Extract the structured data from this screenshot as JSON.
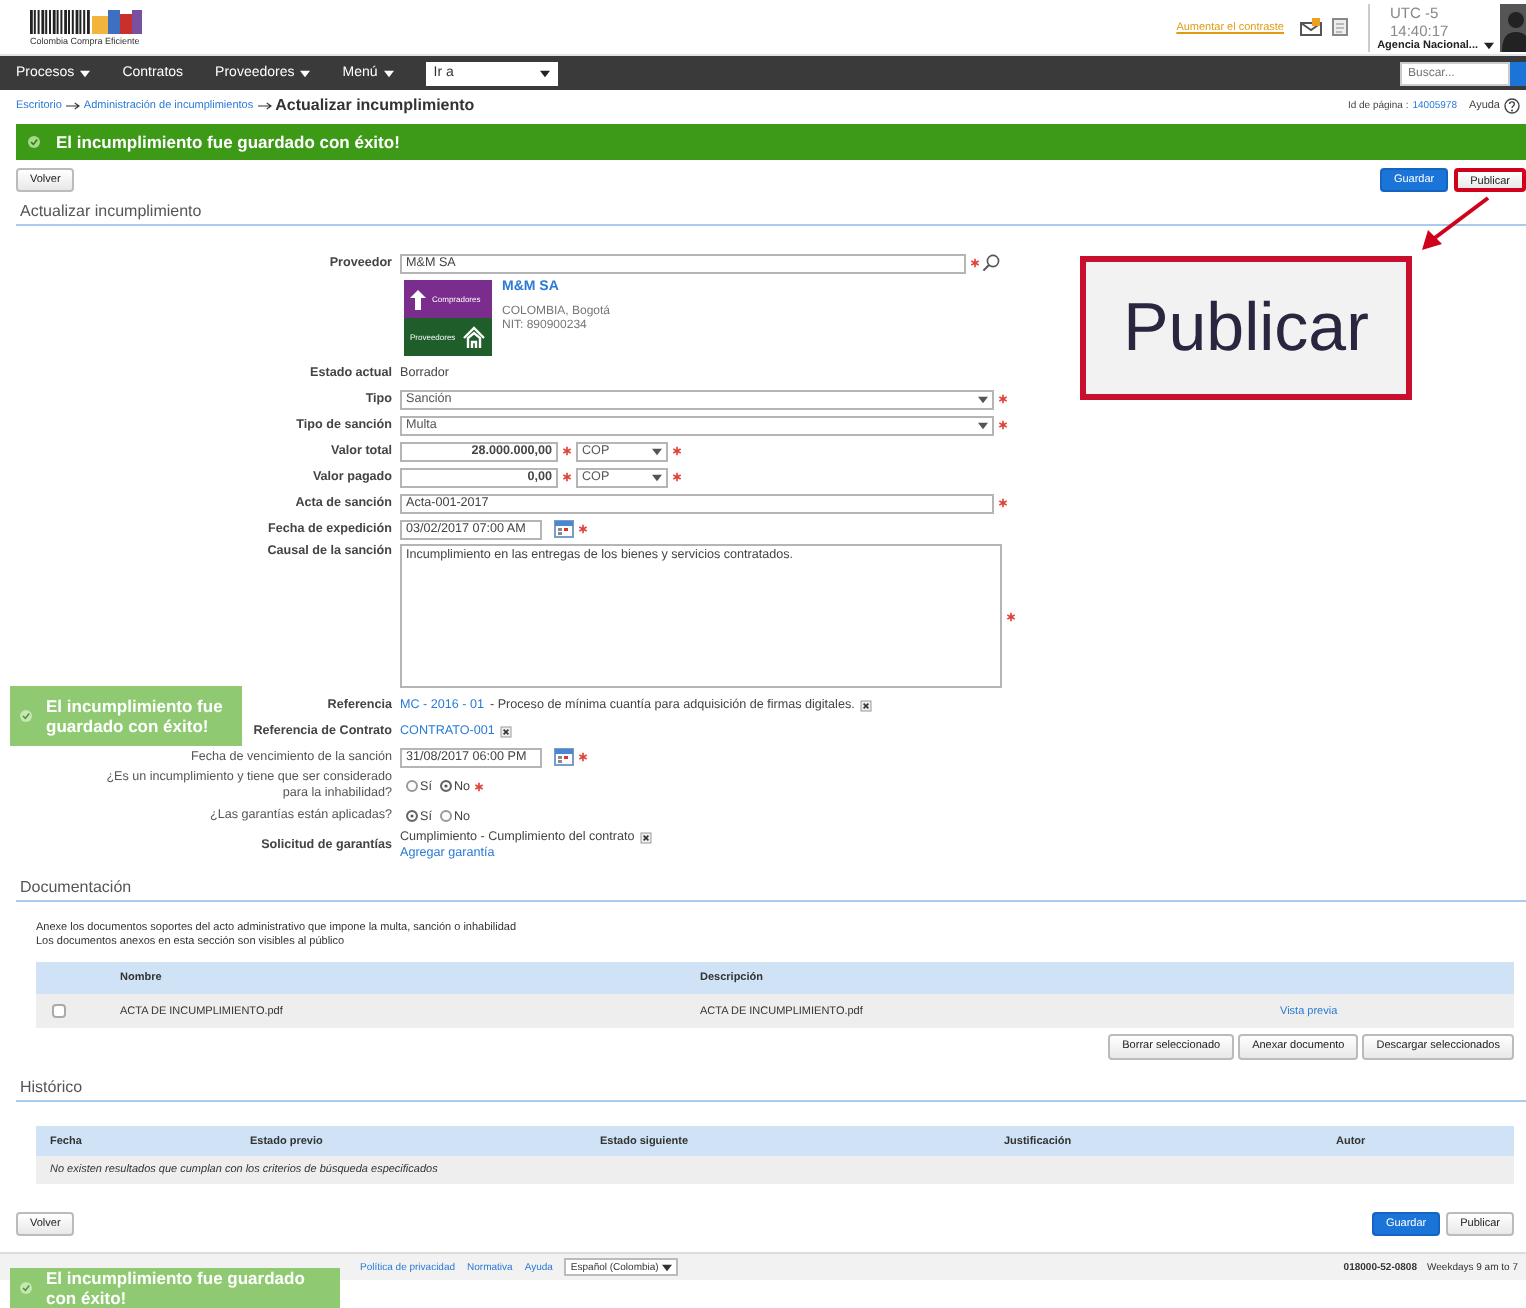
{
  "header": {
    "logo_text": "Colombia Compra Eficiente",
    "contrast_link": "Aumentar el contraste",
    "time": "UTC -5 14:40:17",
    "agency": "Agencia Nacional..."
  },
  "nav": {
    "items": [
      {
        "label": "Procesos",
        "dropdown": true
      },
      {
        "label": "Contratos",
        "dropdown": false
      },
      {
        "label": "Proveedores",
        "dropdown": true
      },
      {
        "label": "Menú",
        "dropdown": true
      }
    ],
    "goto": "Ir a",
    "search_placeholder": "Buscar..."
  },
  "breadcrumb": {
    "links": [
      "Escritorio",
      "Administración de incumplimientos"
    ],
    "current": "Actualizar incumplimiento",
    "page_id_label": "Id de página :",
    "page_id": "14005978",
    "help": "Ayuda"
  },
  "banner": {
    "message": "El incumplimiento fue guardado con éxito!"
  },
  "top_actions": {
    "back": "Volver",
    "save": "Guardar",
    "publish": "Publicar",
    "publish_highlighted": true
  },
  "form": {
    "title": "Actualizar incumplimiento",
    "rows": [
      {
        "kind": "provider",
        "label": "Proveedor",
        "value": "M&M SA",
        "required": true
      },
      {
        "kind": "card",
        "name": "M&M SA",
        "location": "COLOMBIA, Bogotá",
        "nit": "NIT: 890900234",
        "logo_top": "Compradores",
        "logo_bottom": "Proveedores"
      },
      {
        "kind": "static",
        "label": "Estado actual",
        "value": "Borrador"
      },
      {
        "kind": "select",
        "label": "Tipo",
        "value": "Sanción",
        "required": true
      },
      {
        "kind": "select",
        "label": "Tipo de sanción",
        "value": "Multa",
        "required": true
      },
      {
        "kind": "amount",
        "label": "Valor total",
        "value": "28.000.000,00",
        "currency": "COP",
        "required": true
      },
      {
        "kind": "amount",
        "label": "Valor pagado",
        "value": "0,00",
        "currency": "COP",
        "required": true
      },
      {
        "kind": "input",
        "label": "Acta de sanción",
        "value": "Acta-001-2017",
        "required": true
      },
      {
        "kind": "date",
        "label": "Fecha de expedición",
        "value": "03/02/2017 07:00 AM",
        "required": true
      },
      {
        "kind": "textarea",
        "label": "Causal de la sanción",
        "value": "Incumplimiento en las entregas de los bienes y servicios contratados.",
        "required": true
      },
      {
        "kind": "reference",
        "label": "Referencia",
        "link": "MC - 2016 - 01",
        "description": "- Proceso de mínima cuantía para adquisición de firmas digitales."
      },
      {
        "kind": "reference",
        "label": "Referencia de Contrato",
        "link": "CONTRATO-001"
      },
      {
        "kind": "date",
        "label": "Fecha de vencimiento de la sanción",
        "value": "31/08/2017 06:00 PM",
        "required": true,
        "plain_label": true
      },
      {
        "kind": "radio",
        "label": "¿Es un incumplimiento y tiene que ser considerado para la inhabilidad?",
        "options": [
          {
            "label": "Sí",
            "selected": false
          },
          {
            "label": "No",
            "selected": true
          }
        ],
        "required": true,
        "plain_label": true
      },
      {
        "kind": "radio",
        "label": "¿Las garantías están aplicadas?",
        "options": [
          {
            "label": "Sí",
            "selected": true
          },
          {
            "label": "No",
            "selected": false
          }
        ],
        "required": false,
        "plain_label": true
      },
      {
        "kind": "guarantee",
        "label": "Solicitud de garantías",
        "value": "Cumplimiento - Cumplimiento del contrato",
        "link": "Agregar garantía"
      }
    ]
  },
  "documents": {
    "title": "Documentación",
    "notes": [
      "Anexe los documentos soportes del acto administrativo que impone la multa, sanción o inhabilidad",
      "Los documentos anexos en esta sección son visibles al público"
    ],
    "columns": [
      "Nombre",
      "Descripción"
    ],
    "rows": [
      {
        "checked": false,
        "name": "ACTA DE INCUMPLIMIENTO.pdf",
        "description": "ACTA DE INCUMPLIMIENTO.pdf",
        "action": "Vista previa"
      }
    ],
    "buttons": [
      "Borrar seleccionado",
      "Anexar documento",
      "Descargar seleccionados"
    ]
  },
  "history": {
    "title": "Histórico",
    "columns": [
      "Fecha",
      "Estado previo",
      "Estado siguiente",
      "Justificación",
      "Autor"
    ],
    "empty": "No existen resultados que cumplan con los criterios de búsqueda especificados"
  },
  "bottom_actions": {
    "back": "Volver",
    "save": "Guardar",
    "publish": "Publicar"
  },
  "footer": {
    "links": [
      "Política de privacidad",
      "Normativa",
      "Ayuda"
    ],
    "language": "Español (Colombia)",
    "phone": "018000-52-0808",
    "hours": "Weekdays 9 am to 7"
  },
  "toasts": [
    {
      "message": "El incumplimiento fue guardado con éxito!"
    },
    {
      "message": "El incumplimiento fue guardado con éxito!"
    }
  ],
  "callout": {
    "text": "Publicar"
  }
}
